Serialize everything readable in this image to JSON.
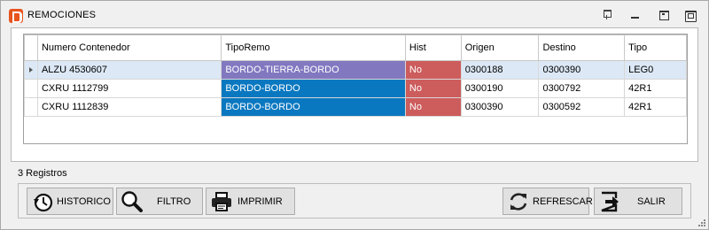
{
  "window": {
    "title": "REMOCIONES"
  },
  "grid": {
    "headers": [
      "Numero Contenedor",
      "TipoRemo",
      "Hist",
      "Origen",
      "Destino",
      "Tipo"
    ],
    "rows": [
      {
        "contenedor": "ALZU 4530607",
        "tiporemo": "BORDO-TIERRA-BORDO",
        "hist": "No",
        "origen": "0300188",
        "destino": "0300390",
        "tipo": "LEG0"
      },
      {
        "contenedor": "CXRU 1112799",
        "tiporemo": "BORDO-BORDO",
        "hist": "No",
        "origen": "0300190",
        "destino": "0300792",
        "tipo": "42R1"
      },
      {
        "contenedor": "CXRU 1112839",
        "tiporemo": "BORDO-BORDO",
        "hist": "No",
        "origen": "0300390",
        "destino": "0300592",
        "tipo": "42R1"
      }
    ],
    "colors": {
      "tierra_bordo": "#8178c0",
      "bordo_bordo": "#0a78c0",
      "hist_no": "#cd5c5c",
      "selected_row": "#dce8f5"
    }
  },
  "status": {
    "count": "3 Registros"
  },
  "buttons": {
    "historico": "HISTORICO",
    "filtro": "FILTRO",
    "imprimir": "IMPRIMIR",
    "refrescar": "REFRESCAR",
    "salir": "SALIR"
  }
}
